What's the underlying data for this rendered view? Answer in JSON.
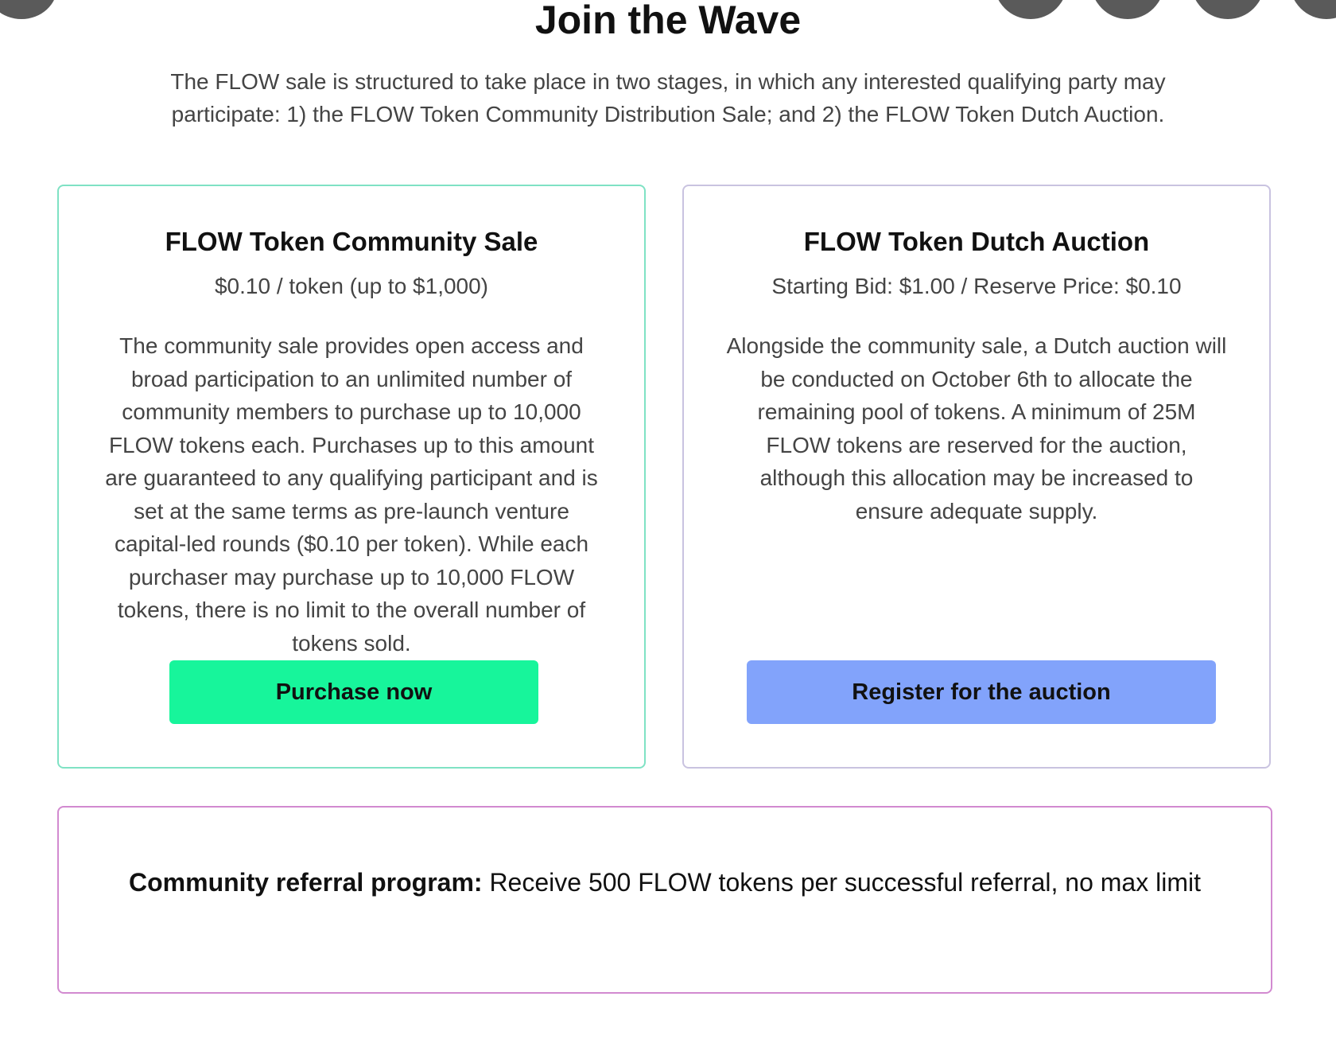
{
  "page": {
    "title": "Join the Wave",
    "intro": "The FLOW sale is structured to take place in two stages, in which any interested qualifying party may participate: 1) the FLOW Token Community Distribution Sale; and 2) the FLOW Token Dutch Auction."
  },
  "cards": [
    {
      "title": "FLOW Token Community Sale",
      "price": "$0.10 / token (up to $1,000)",
      "description": "The community sale provides open access and broad participation to an unlimited number of community members to purchase up to 10,000 FLOW tokens each. Purchases up to this amount are guaranteed to any qualifying participant and is set at the same terms as pre-launch venture capital-led rounds ($0.10 per token). While each purchaser may purchase up to 10,000 FLOW tokens, there is no limit to the overall number of tokens sold.",
      "button_label": "Purchase now",
      "accent_color": "#17f59b",
      "border_color": "#7fe2c4"
    },
    {
      "title": "FLOW Token Dutch Auction",
      "price": "Starting Bid: $1.00 / Reserve Price: $0.10",
      "description": "Alongside the community sale, a Dutch auction will be conducted on October 6th to allocate the remaining pool of tokens. A minimum of 25M FLOW tokens are reserved for the auction, although this allocation may be increased to ensure adequate supply.",
      "button_label": "Register for the auction",
      "accent_color": "#82a3fb",
      "border_color": "#c9c3e0"
    }
  ],
  "referral": {
    "label": "Community referral program:",
    "text": "Receive 500 FLOW tokens per successful referral, no max limit",
    "border_color": "#d28ad0"
  }
}
